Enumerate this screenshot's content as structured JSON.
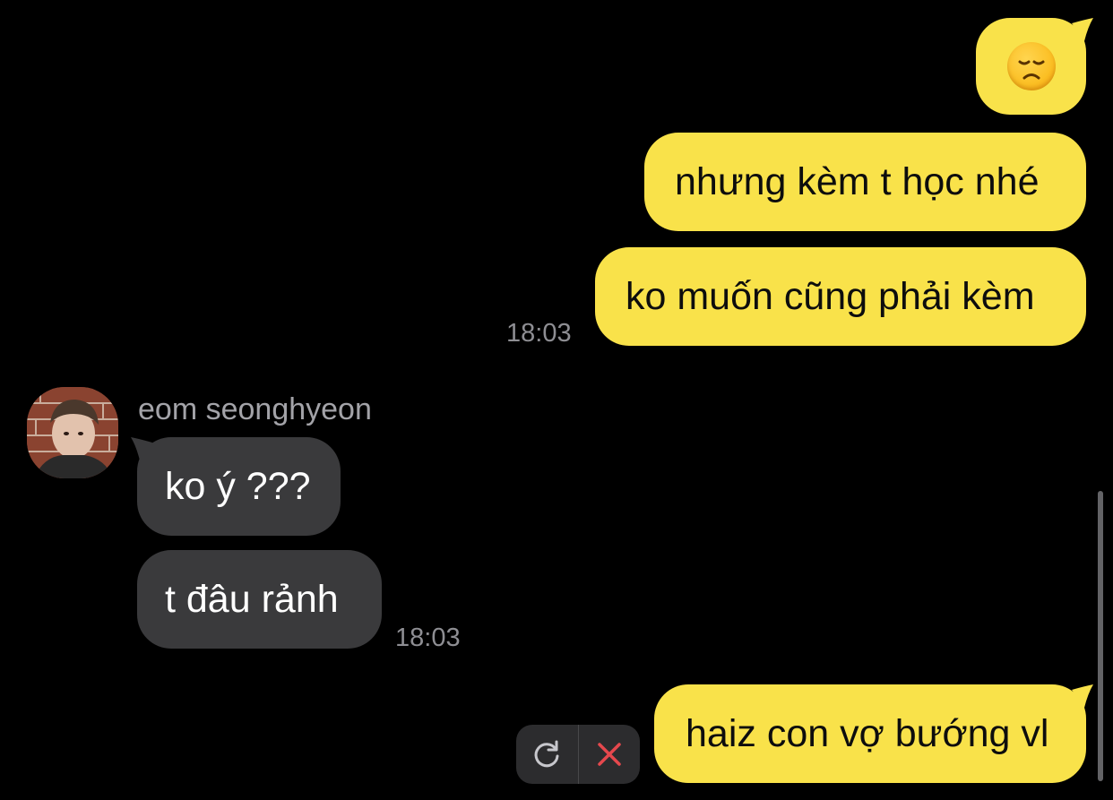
{
  "messages": {
    "out1": {
      "emoji": "disappointed-face-emoji"
    },
    "out2": {
      "text": "nhưng kèm t học nhé"
    },
    "out3": {
      "text": "ko muốn cũng phải kèm",
      "time": "18:03"
    },
    "in_sender": "eom seonghyeon",
    "in1": {
      "text": "ko ý ???"
    },
    "in2": {
      "text": "t đâu rảnh",
      "time": "18:03"
    },
    "out4": {
      "text": "haiz con vợ bướng vl"
    }
  },
  "actions": {
    "retry_icon": "retry-icon",
    "delete_icon": "close-icon"
  },
  "colors": {
    "background": "#000000",
    "outgoing_bubble": "#f9e24a",
    "incoming_bubble": "#3a3a3c",
    "timestamp": "#8e8e93",
    "delete_red": "#e5484d"
  }
}
